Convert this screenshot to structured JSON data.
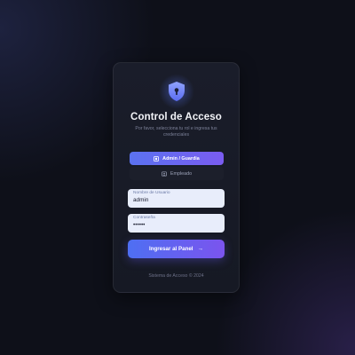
{
  "card": {
    "title": "Control de Acceso",
    "subtitle": "Por favor, selecciona tu rol e ingresa tus credenciales",
    "logo_icon": "shield-lock-icon"
  },
  "roles": {
    "admin": {
      "label": "Admin / Guardia",
      "icon": "admin-badge-icon",
      "selected": true
    },
    "employee": {
      "label": "Empleado",
      "icon": "employee-id-icon",
      "selected": false
    }
  },
  "form": {
    "username": {
      "label": "Nombre de Usuario",
      "value": "admin"
    },
    "password": {
      "label": "Contraseña",
      "value": "••••••"
    },
    "submit_label": "Ingresar al Panel",
    "submit_icon": "arrow-right-icon"
  },
  "footer": {
    "text": "Sistema de Acceso © 2024"
  },
  "colors": {
    "background": "#0e1019",
    "card": "#1a1d2a",
    "accent_start": "#4e6ff2",
    "accent_end": "#7b54ee",
    "field": "#e8edfb"
  }
}
